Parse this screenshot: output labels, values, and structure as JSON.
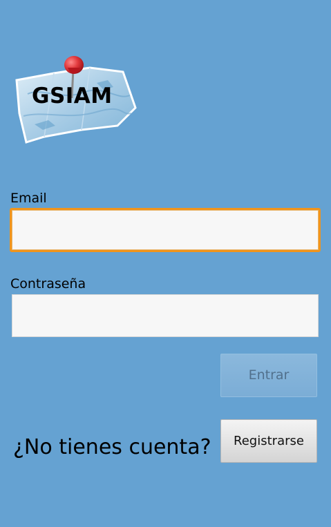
{
  "app": {
    "logo_text": "GSIAM",
    "logo_icon": "map-pin-icon"
  },
  "form": {
    "email_label": "Email",
    "email_value": "",
    "password_label": "Contraseña",
    "password_value": "",
    "submit_label": "Entrar"
  },
  "signup": {
    "prompt": "¿No tienes cuenta?",
    "button_label": "Registrarse"
  },
  "colors": {
    "background": "#65a2d2",
    "focus_border": "#f0941c",
    "pin": "#d8262c"
  }
}
